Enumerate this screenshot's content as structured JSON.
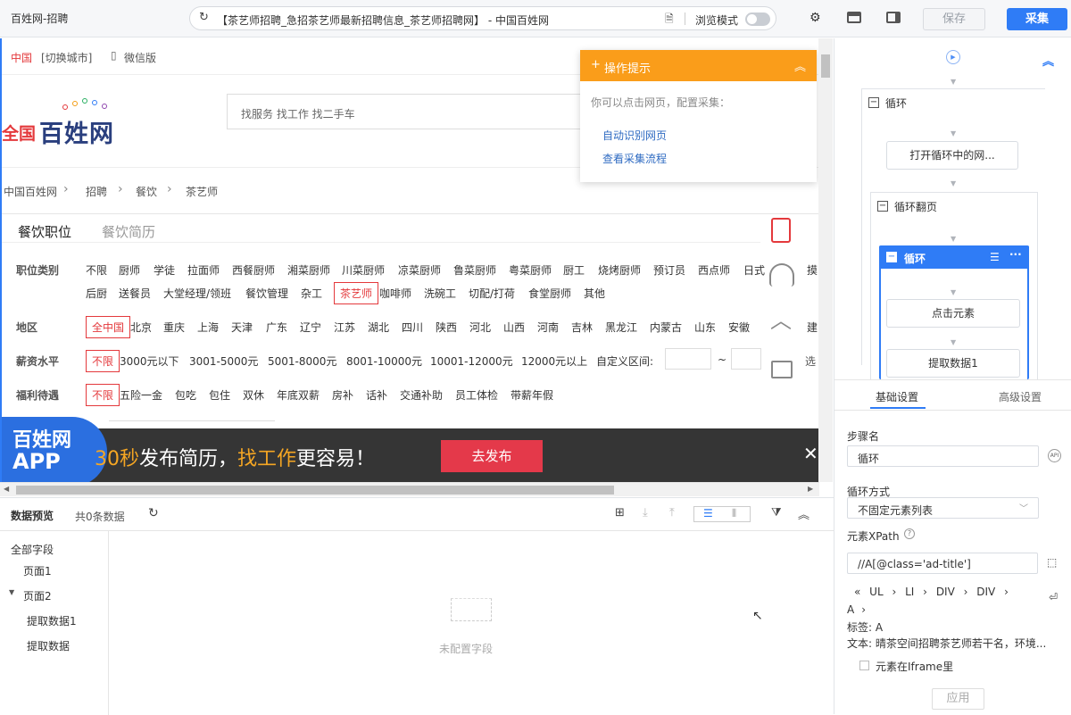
{
  "topbar": {
    "app_title": "百姓网-招聘",
    "url": "【茶艺师招聘_急招茶艺师最新招聘信息_茶艺师招聘网】 - 中国百姓网",
    "browse_mode": "浏览模式",
    "save": "保存",
    "collect": "采集"
  },
  "site": {
    "region": "中国",
    "switch_city": "[切换城市]",
    "wechat": "微信版",
    "logo_prefix": "全国",
    "logo_main": "百姓网",
    "search_placeholder": "找服务 找工作 找二手车",
    "breadcrumb": [
      "中国百姓网",
      "招聘",
      "餐饮",
      "茶艺师"
    ],
    "tabs": [
      "餐饮职位",
      "餐饮简历"
    ],
    "job_label": "职位类别",
    "jobs_row1": [
      "不限",
      "厨师",
      "学徒",
      "拉面师",
      "西餐厨师",
      "湘菜厨师",
      "川菜厨师",
      "凉菜厨师",
      "鲁菜厨师",
      "粤菜厨师",
      "厨工",
      "烧烤厨师",
      "预订员",
      "西点师",
      "日式",
      "摸"
    ],
    "jobs_row2": [
      "后厨",
      "送餐员",
      "大堂经理/领班",
      "餐饮管理",
      "杂工",
      "茶艺师",
      "咖啡师",
      "洗碗工",
      "切配/打荷",
      "食堂厨师",
      "其他"
    ],
    "area_label": "地区",
    "areas": [
      "全中国",
      "北京",
      "重庆",
      "上海",
      "天津",
      "广东",
      "辽宁",
      "江苏",
      "湖北",
      "四川",
      "陕西",
      "河北",
      "山西",
      "河南",
      "吉林",
      "黑龙江",
      "内蒙古",
      "山东",
      "安徽",
      "建"
    ],
    "salary_label": "薪资水平",
    "salaries": [
      "不限",
      "3000元以下",
      "3001-5000元",
      "5001-8000元",
      "8001-10000元",
      "10001-12000元",
      "12000元以上"
    ],
    "custom_range": "自定义区间:",
    "tilde": "~",
    "salary_more": "选",
    "benefit_label": "福利待遇",
    "benefits": [
      "不限",
      "五险一金",
      "包吃",
      "包住",
      "双休",
      "年底双薪",
      "房补",
      "话补",
      "交通补助",
      "员工体检",
      "带薪年假"
    ],
    "banner_app_line1": "百姓网",
    "banner_app_line2": "APP",
    "banner_text_a": "30秒",
    "banner_text_b": "发布简历，",
    "banner_text_c": "找工作",
    "banner_text_d": "更容易！",
    "banner_btn": "去发布"
  },
  "tips": {
    "title": "操作提示",
    "intro": "你可以点击网页，配置采集：",
    "link1": "自动识别网页",
    "link2": "查看采集流程"
  },
  "preview": {
    "title": "数据预览",
    "count": "共0条数据",
    "fields_all": "全部字段",
    "page1": "页面1",
    "page2": "页面2",
    "extract1": "提取数据1",
    "extract": "提取数据",
    "empty": "未配置字段"
  },
  "flow": {
    "loop": "循环",
    "open_loop": "打开循环中的网...",
    "loop_page": "循环翻页",
    "loop_inner": "循环",
    "click": "点击元素",
    "extract": "提取数据1"
  },
  "settings": {
    "tab_basic": "基础设置",
    "tab_adv": "高级设置",
    "step_name_label": "步骤名",
    "step_name": "循环",
    "loop_mode_label": "循环方式",
    "loop_mode": "不固定元素列表",
    "xpath_label": "元素XPath",
    "xpath": "//A[@class='ad-title']",
    "path_nodes": [
      "UL",
      "LI",
      "DIV",
      "DIV",
      "A"
    ],
    "tag_line": "标签:  A",
    "text_line": "文本:  晴茶空间招聘茶艺师若干名，环境...",
    "iframe": "元素在Iframe里",
    "apply": "应用"
  }
}
